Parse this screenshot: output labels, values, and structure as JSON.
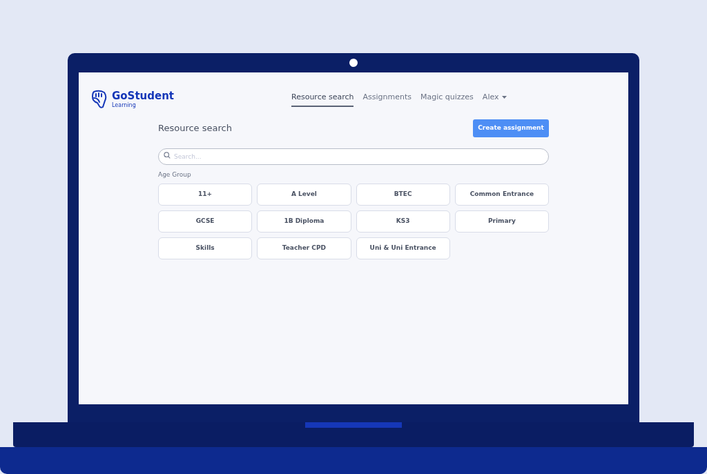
{
  "brand": {
    "name": "GoStudent",
    "sub": "Learning"
  },
  "nav": [
    {
      "label": "Resource search",
      "selected": true
    },
    {
      "label": "Assignments",
      "selected": false
    },
    {
      "label": "Magic quizzes",
      "selected": false
    }
  ],
  "user": {
    "name": "Alex"
  },
  "page": {
    "title": "Resource search",
    "action": "Create assignment"
  },
  "search": {
    "placeholder": "Search..."
  },
  "filter": {
    "label": "Age Group",
    "options": [
      "11+",
      "A Level",
      "BTEC",
      "Common Entrance",
      "GCSE",
      "1B Diploma",
      "KS3",
      "Primary",
      "Skills",
      "Teacher CPD",
      "Uni & Uni Entrance"
    ]
  }
}
